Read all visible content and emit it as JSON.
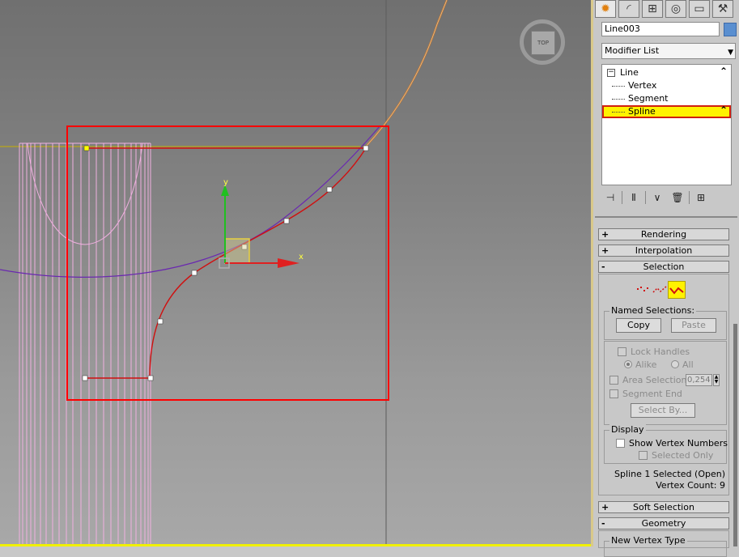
{
  "viewport": {
    "viewcube_label": "TOP",
    "gizmo_axis_y": "y",
    "gizmo_axis_x": "x",
    "colors": {
      "spline_selected": "#d01010",
      "spline_other": "#6020a0",
      "mesh": "#f0b0e0",
      "selection_rect": "#ff0000",
      "vertex": "#ffffff",
      "first_vertex": "#ffff00"
    }
  },
  "command_panel": {
    "tabs": [
      {
        "name": "create-tab-icon",
        "glyph": "✹"
      },
      {
        "name": "modify-tab-icon",
        "glyph": "◜"
      },
      {
        "name": "hierarchy-tab-icon",
        "glyph": "⊞"
      },
      {
        "name": "motion-tab-icon",
        "glyph": "◎"
      },
      {
        "name": "display-tab-icon",
        "glyph": "▭"
      },
      {
        "name": "utilities-tab-icon",
        "glyph": "⚒"
      }
    ],
    "object_name": "Line003",
    "object_color": "#5a8fd0",
    "modifier_list": "Modifier List",
    "stack": {
      "root": "Line",
      "sub_levels": [
        "Vertex",
        "Segment",
        "Spline"
      ],
      "selected": "Spline"
    }
  },
  "rollouts": {
    "rendering": {
      "sign": "+",
      "title": "Rendering"
    },
    "interpolation": {
      "sign": "+",
      "title": "Interpolation"
    },
    "selection": {
      "sign": "-",
      "title": "Selection",
      "named_selections": "Named Selections:",
      "copy": "Copy",
      "paste": "Paste",
      "lock_handles": "Lock Handles",
      "alike": "Alike",
      "all": "All",
      "area_selection": "Area Selection:",
      "area_value": "0,254",
      "segment_end": "Segment End",
      "select_by": "Select By...",
      "display": "Display",
      "show_vertex_numbers": "Show Vertex Numbers",
      "selected_only": "Selected Only",
      "status_line1": "Spline 1 Selected (Open)",
      "status_line2": "Vertex Count: 9"
    },
    "soft_selection": {
      "sign": "+",
      "title": "Soft Selection"
    },
    "geometry": {
      "sign": "-",
      "title": "Geometry",
      "new_vertex_type": "New Vertex Type"
    }
  }
}
